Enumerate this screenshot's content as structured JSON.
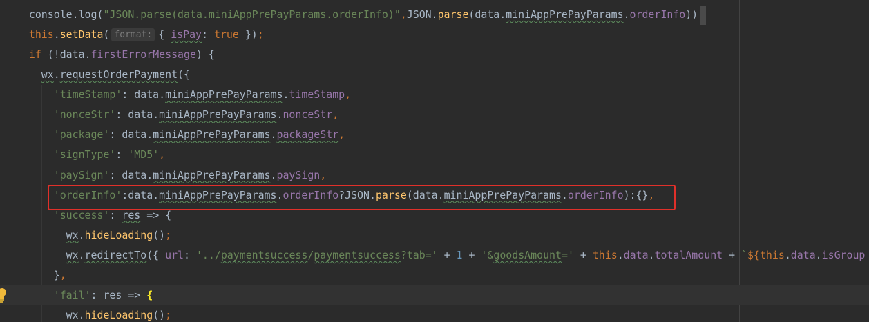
{
  "colors": {
    "background": "#2b2b2b",
    "current_line": "#323232",
    "plain": "#a9b7c6",
    "keyword": "#cc7832",
    "string": "#6a8759",
    "field": "#9876aa",
    "function": "#ffc66d",
    "number": "#6897bb",
    "brace_match": "#ffef28",
    "annotation_box": "#e0302a"
  },
  "gutter": {
    "intention_icon": "lightbulb-icon"
  },
  "editor": {
    "lines": [
      {
        "tokens": [
          {
            "t": "    "
          },
          {
            "t": "console.log(",
            "color": "#a9b7c6"
          },
          {
            "t": "\"JSON.parse(data.miniAppPrePayParams.orderInfo)\"",
            "color": "#6a8759"
          },
          {
            "t": ",",
            "color": "#cc7832"
          },
          {
            "t": "JSON.",
            "color": "#a9b7c6"
          },
          {
            "t": "parse",
            "color": "#ffc66d"
          },
          {
            "t": "(data.",
            "color": "#a9b7c6"
          },
          {
            "t": "miniAppPrePayParams",
            "color": "#a9b7c6",
            "u": true
          },
          {
            "t": ".",
            "color": "#a9b7c6"
          },
          {
            "t": "orderInfo",
            "color": "#9876aa"
          },
          {
            "t": "))",
            "color": "#a9b7c6"
          }
        ]
      },
      {
        "tokens": [
          {
            "t": "    "
          },
          {
            "t": "this",
            "color": "#cc7832"
          },
          {
            "t": ".",
            "color": "#a9b7c6"
          },
          {
            "t": "setData",
            "color": "#ffc66d"
          },
          {
            "t": "(",
            "color": "#a9b7c6"
          },
          {
            "t": "format:",
            "hint": true
          },
          {
            "t": "{ ",
            "color": "#a9b7c6"
          },
          {
            "t": "isPay",
            "color": "#9876aa",
            "u": true
          },
          {
            "t": ": ",
            "color": "#a9b7c6"
          },
          {
            "t": "true",
            "color": "#cc7832"
          },
          {
            "t": " })",
            "color": "#a9b7c6"
          },
          {
            "t": ";",
            "color": "#cc7832"
          }
        ]
      },
      {
        "tokens": [
          {
            "t": "    "
          },
          {
            "t": "if",
            "color": "#cc7832"
          },
          {
            "t": " (!data.",
            "color": "#a9b7c6"
          },
          {
            "t": "firstErrorMessage",
            "color": "#9876aa"
          },
          {
            "t": ") {",
            "color": "#a9b7c6"
          }
        ]
      },
      {
        "tokens": [
          {
            "t": "      "
          },
          {
            "t": "wx",
            "color": "#a9b7c6",
            "u": true
          },
          {
            "t": ".",
            "color": "#a9b7c6"
          },
          {
            "t": "requestOrderPayment",
            "color": "#a9b7c6",
            "u": true
          },
          {
            "t": "({",
            "color": "#a9b7c6"
          }
        ]
      },
      {
        "tokens": [
          {
            "t": "        "
          },
          {
            "t": "'timeStamp'",
            "color": "#6a8759"
          },
          {
            "t": ": data.",
            "color": "#a9b7c6"
          },
          {
            "t": "miniAppPrePayParams",
            "color": "#a9b7c6",
            "u": true
          },
          {
            "t": ".",
            "color": "#a9b7c6"
          },
          {
            "t": "timeStamp",
            "color": "#9876aa"
          },
          {
            "t": ",",
            "color": "#cc7832"
          }
        ]
      },
      {
        "tokens": [
          {
            "t": "        "
          },
          {
            "t": "'nonceStr'",
            "color": "#6a8759"
          },
          {
            "t": ": data.",
            "color": "#a9b7c6"
          },
          {
            "t": "miniAppPrePayParams",
            "color": "#a9b7c6",
            "u": true
          },
          {
            "t": ".",
            "color": "#a9b7c6"
          },
          {
            "t": "nonceStr",
            "color": "#9876aa"
          },
          {
            "t": ",",
            "color": "#cc7832"
          }
        ]
      },
      {
        "tokens": [
          {
            "t": "        "
          },
          {
            "t": "'package'",
            "color": "#6a8759"
          },
          {
            "t": ": data.",
            "color": "#a9b7c6"
          },
          {
            "t": "miniAppPrePayParams",
            "color": "#a9b7c6",
            "u": true
          },
          {
            "t": ".",
            "color": "#a9b7c6"
          },
          {
            "t": "packageStr",
            "color": "#9876aa",
            "u": true
          },
          {
            "t": ",",
            "color": "#cc7832"
          }
        ]
      },
      {
        "tokens": [
          {
            "t": "        "
          },
          {
            "t": "'signType'",
            "color": "#6a8759"
          },
          {
            "t": ": ",
            "color": "#a9b7c6"
          },
          {
            "t": "'MD5'",
            "color": "#6a8759"
          },
          {
            "t": ",",
            "color": "#cc7832"
          }
        ]
      },
      {
        "tokens": [
          {
            "t": "        "
          },
          {
            "t": "'paySign'",
            "color": "#6a8759"
          },
          {
            "t": ": data.",
            "color": "#a9b7c6"
          },
          {
            "t": "miniAppPrePayParams",
            "color": "#a9b7c6",
            "u": true
          },
          {
            "t": ".",
            "color": "#a9b7c6"
          },
          {
            "t": "paySign",
            "color": "#9876aa"
          },
          {
            "t": ",",
            "color": "#cc7832"
          }
        ]
      },
      {
        "tokens": [
          {
            "t": "        "
          },
          {
            "t": "'orderInfo'",
            "color": "#6a8759"
          },
          {
            "t": ":data.",
            "color": "#a9b7c6"
          },
          {
            "t": "miniAppPrePayParams",
            "color": "#a9b7c6",
            "u": true
          },
          {
            "t": ".",
            "color": "#a9b7c6"
          },
          {
            "t": "orderInfo",
            "color": "#9876aa"
          },
          {
            "t": "?JSON.",
            "color": "#a9b7c6"
          },
          {
            "t": "parse",
            "color": "#ffc66d"
          },
          {
            "t": "(data.",
            "color": "#a9b7c6"
          },
          {
            "t": "miniAppPrePayParams",
            "color": "#a9b7c6",
            "u": true
          },
          {
            "t": ".",
            "color": "#a9b7c6"
          },
          {
            "t": "orderInfo",
            "color": "#9876aa"
          },
          {
            "t": "):{}",
            "color": "#a9b7c6"
          },
          {
            "t": ",",
            "color": "#cc7832"
          }
        ]
      },
      {
        "tokens": [
          {
            "t": "        "
          },
          {
            "t": "'success'",
            "color": "#6a8759"
          },
          {
            "t": ": ",
            "color": "#a9b7c6"
          },
          {
            "t": "res",
            "color": "#a9b7c6",
            "u": true
          },
          {
            "t": " => {",
            "color": "#a9b7c6"
          }
        ]
      },
      {
        "tokens": [
          {
            "t": "          "
          },
          {
            "t": "wx",
            "color": "#a9b7c6",
            "u": true
          },
          {
            "t": ".",
            "color": "#a9b7c6"
          },
          {
            "t": "hideLoading",
            "color": "#ffc66d"
          },
          {
            "t": "()",
            "color": "#a9b7c6"
          },
          {
            "t": ";",
            "color": "#cc7832"
          }
        ]
      },
      {
        "tokens": [
          {
            "t": "          "
          },
          {
            "t": "wx",
            "color": "#a9b7c6",
            "u": true
          },
          {
            "t": ".",
            "color": "#a9b7c6"
          },
          {
            "t": "redirectTo",
            "color": "#a9b7c6",
            "u": true
          },
          {
            "t": "({ ",
            "color": "#a9b7c6"
          },
          {
            "t": "url",
            "color": "#9876aa"
          },
          {
            "t": ": ",
            "color": "#a9b7c6"
          },
          {
            "t": "'../",
            "color": "#6a8759"
          },
          {
            "t": "paymentsuccess",
            "color": "#6a8759",
            "u": true
          },
          {
            "t": "/",
            "color": "#6a8759"
          },
          {
            "t": "paymentsuccess",
            "color": "#6a8759",
            "u": true
          },
          {
            "t": "?tab='",
            "color": "#6a8759"
          },
          {
            "t": " + ",
            "color": "#a9b7c6"
          },
          {
            "t": "1",
            "color": "#6897bb"
          },
          {
            "t": " + ",
            "color": "#a9b7c6"
          },
          {
            "t": "'&",
            "color": "#6a8759"
          },
          {
            "t": "goodsAmount",
            "color": "#6a8759",
            "u": true
          },
          {
            "t": "='",
            "color": "#6a8759"
          },
          {
            "t": " + ",
            "color": "#a9b7c6"
          },
          {
            "t": "this",
            "color": "#cc7832"
          },
          {
            "t": ".",
            "color": "#a9b7c6"
          },
          {
            "t": "data",
            "color": "#9876aa"
          },
          {
            "t": ".",
            "color": "#a9b7c6"
          },
          {
            "t": "totalAmount",
            "color": "#9876aa"
          },
          {
            "t": " + ",
            "color": "#a9b7c6"
          },
          {
            "t": "`",
            "color": "#6a8759"
          },
          {
            "t": "${",
            "color": "#cc7832"
          },
          {
            "t": "this",
            "color": "#cc7832"
          },
          {
            "t": ".",
            "color": "#a9b7c6"
          },
          {
            "t": "data",
            "color": "#9876aa"
          },
          {
            "t": ".",
            "color": "#a9b7c6"
          },
          {
            "t": "isGroup",
            "color": "#9876aa"
          }
        ]
      },
      {
        "tokens": [
          {
            "t": "        "
          },
          {
            "t": "}",
            "color": "#a9b7c6"
          },
          {
            "t": ",",
            "color": "#cc7832"
          }
        ]
      },
      {
        "current": true,
        "tokens": [
          {
            "t": "        "
          },
          {
            "t": "'fail'",
            "color": "#6a8759"
          },
          {
            "t": ": res => ",
            "color": "#a9b7c6"
          },
          {
            "t": "{",
            "color": "#ffef28",
            "bold": true
          }
        ]
      },
      {
        "tokens": [
          {
            "t": "          "
          },
          {
            "t": "wx",
            "color": "#a9b7c6",
            "u": true
          },
          {
            "t": ".",
            "color": "#a9b7c6"
          },
          {
            "t": "hideLoading",
            "color": "#ffc66d"
          },
          {
            "t": "()",
            "color": "#a9b7c6"
          },
          {
            "t": ";",
            "color": "#cc7832"
          }
        ]
      }
    ]
  }
}
